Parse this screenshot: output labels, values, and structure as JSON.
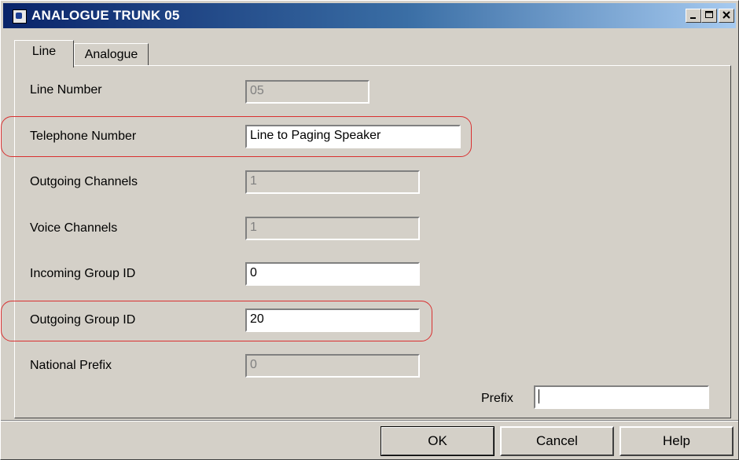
{
  "window": {
    "title": "ANALOGUE TRUNK 05",
    "controls": {
      "minimize": "_",
      "maximize": "□",
      "close": "×"
    }
  },
  "tabs": [
    {
      "label": "Line",
      "active": true
    },
    {
      "label": "Analogue",
      "active": false
    }
  ],
  "form": {
    "line_number": {
      "label": "Line Number",
      "value": "05",
      "enabled": false
    },
    "telephone_number": {
      "label": "Telephone Number",
      "value": "Line to Paging Speaker",
      "enabled": true,
      "highlighted": true
    },
    "outgoing_channels": {
      "label": "Outgoing Channels",
      "value": "1",
      "enabled": false
    },
    "voice_channels": {
      "label": "Voice Channels",
      "value": "1",
      "enabled": false
    },
    "incoming_group_id": {
      "label": "Incoming Group ID",
      "value": "0",
      "enabled": true
    },
    "outgoing_group_id": {
      "label": "Outgoing Group ID",
      "value": "20",
      "enabled": true,
      "highlighted": true
    },
    "national_prefix": {
      "label": "National Prefix",
      "value": "0",
      "enabled": false
    },
    "prefix": {
      "label": "Prefix",
      "value": "",
      "enabled": true
    }
  },
  "buttons": {
    "ok": "OK",
    "cancel": "Cancel",
    "help": "Help"
  },
  "colors": {
    "highlight": "#d93030",
    "title_start": "#0a246a",
    "title_end": "#a6caf0"
  }
}
